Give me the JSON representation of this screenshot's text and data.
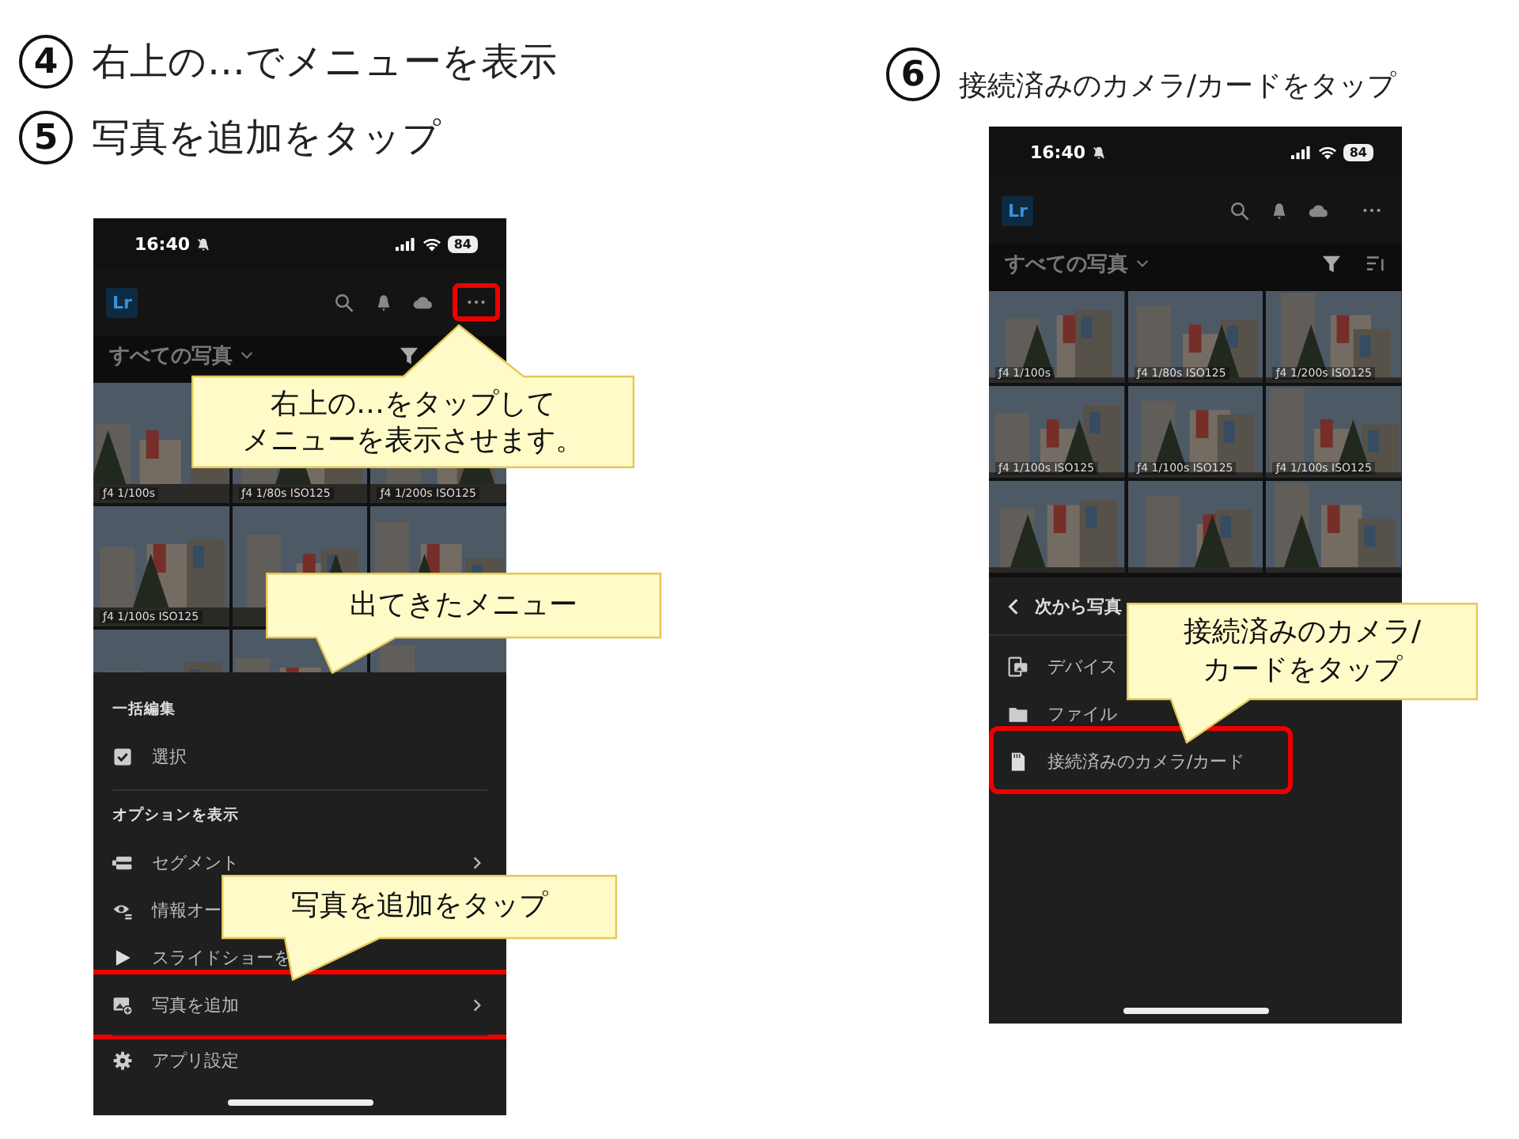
{
  "steps": [
    {
      "number": "4",
      "text": "右上の…でメニューを表示"
    },
    {
      "number": "5",
      "text": "写真を追加をタップ"
    },
    {
      "number": "6",
      "text": "接続済みのカメラ/カードをタップ"
    }
  ],
  "phones": [
    {
      "status_bar": {
        "time": "16:40",
        "battery": "84"
      },
      "header": {
        "logo": "Lr",
        "more_highlighted": true
      },
      "album_title": "すべての写真",
      "sort_visible": false,
      "photos": [
        {
          "kind": "picture",
          "caption": "ƒ4 1/100s"
        },
        {
          "kind": "picture",
          "caption": "ƒ4 1/80s ISO125"
        },
        {
          "kind": "picture",
          "caption": "ƒ4 1/200s ISO125"
        },
        {
          "kind": "picture",
          "caption": "ƒ4 1/100s ISO125"
        },
        {
          "kind": "picture"
        },
        {
          "kind": "picture"
        },
        {
          "kind": "picture"
        },
        {
          "kind": "picture"
        },
        {
          "kind": "picture"
        }
      ],
      "menu": {
        "sections": [
          {
            "heading": "一括編集",
            "items": [
              {
                "kind": "select",
                "label": "選択",
                "chevron": false,
                "highlighted": false,
                "separated": false
              }
            ]
          },
          {
            "heading": "オプションを表示",
            "items": [
              {
                "kind": "segment",
                "label": "セグメント",
                "chevron": true,
                "highlighted": false,
                "separated": false
              },
              {
                "kind": "overlay",
                "label": "情報オー",
                "chevron": false,
                "highlighted": false,
                "separated": false
              },
              {
                "kind": "slideshow",
                "label": "スライドショーを",
                "chevron": false,
                "highlighted": false,
                "separated": false
              },
              {
                "kind": "add-photos",
                "label": "写真を追加",
                "chevron": true,
                "highlighted": true,
                "separated": false
              },
              {
                "kind": "settings",
                "label": "アプリ設定",
                "chevron": false,
                "highlighted": false,
                "separated": true
              }
            ]
          }
        ]
      },
      "callouts": [
        {
          "lines": [
            "右上の…をタップして",
            "メニューを表示させます。"
          ]
        },
        {
          "lines": [
            "出てきたメニュー"
          ]
        },
        {
          "lines": [
            "写真を追加をタップ"
          ]
        }
      ]
    },
    {
      "status_bar": {
        "time": "16:40",
        "battery": "84"
      },
      "header": {
        "logo": "Lr",
        "more_highlighted": false
      },
      "album_title": "すべての写真",
      "sort_visible": true,
      "photos": [
        {
          "kind": "picture",
          "caption": "ƒ4 1/100s"
        },
        {
          "kind": "picture",
          "caption": "ƒ4 1/80s ISO125"
        },
        {
          "kind": "picture",
          "caption": "ƒ4 1/200s ISO125"
        },
        {
          "kind": "picture",
          "caption": "ƒ4 1/100s ISO125"
        },
        {
          "kind": "picture",
          "caption": "ƒ4 1/100s ISO125"
        },
        {
          "kind": "picture",
          "caption": "ƒ4 1/100s ISO125"
        },
        {
          "kind": "picture"
        },
        {
          "kind": "picture"
        },
        {
          "kind": "picture"
        }
      ],
      "menu": {
        "back_title": "次から写真",
        "items": [
          {
            "kind": "device",
            "label": "デバイス",
            "chevron": false,
            "highlighted": false,
            "separated": false
          },
          {
            "kind": "files",
            "label": "ファイル",
            "chevron": false,
            "highlighted": false,
            "separated": false
          },
          {
            "kind": "card",
            "label": "接続済みのカメラ/カード",
            "chevron": false,
            "highlighted": true,
            "separated": false
          }
        ]
      },
      "callouts": [
        {
          "lines": [
            "接続済みのカメラ/",
            "カードをタップ"
          ]
        }
      ]
    }
  ]
}
